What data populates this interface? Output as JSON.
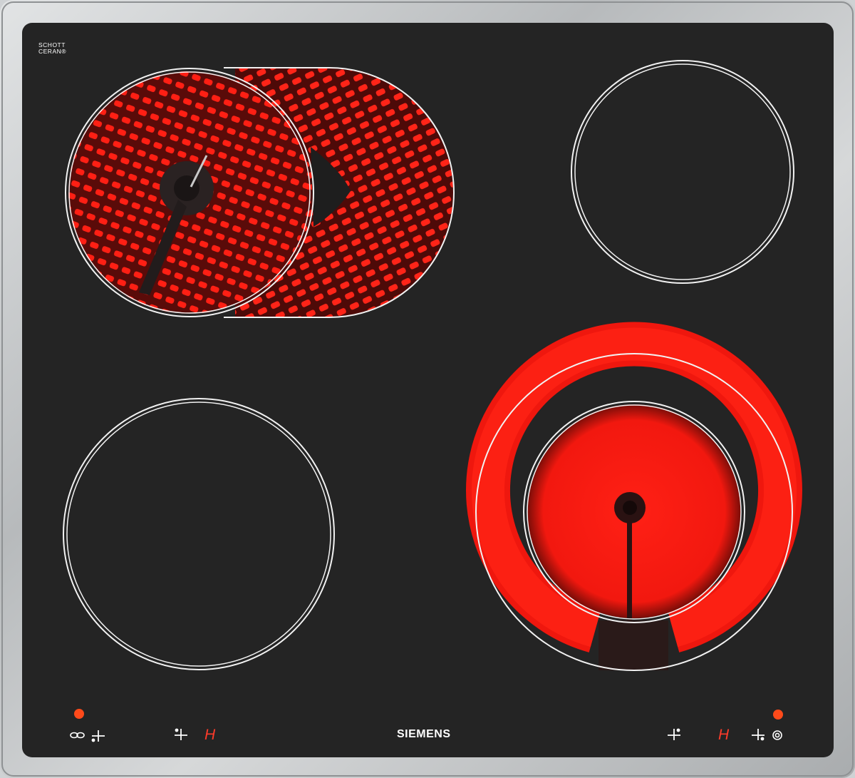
{
  "brand": {
    "manufacturer_logo": "SIEMENS",
    "glass_logo_line1": "SCHOTT",
    "glass_logo_line2": "CERAN®"
  },
  "zones": [
    {
      "name": "front-left-extended-zone",
      "state": "on",
      "type": "oval dual zone"
    },
    {
      "name": "rear-right-zone",
      "state": "off",
      "type": "single circle"
    },
    {
      "name": "rear-left-zone",
      "state": "off",
      "type": "single circle"
    },
    {
      "name": "front-right-dual-zone",
      "state": "on",
      "type": "dual circle"
    }
  ],
  "controls": {
    "residual_heat_left": "H",
    "residual_heat_right": "H",
    "left_indicator_led": "on",
    "right_indicator_led": "on",
    "icons": [
      "extended-zone-icon",
      "zone-position-icon",
      "dual-zone-icon"
    ]
  },
  "colors": {
    "glass": "#242424",
    "frame": "#c6c9cb",
    "heat": "#ff1a12",
    "led": "#ff4a1a",
    "ring": "#f2f2f2"
  }
}
